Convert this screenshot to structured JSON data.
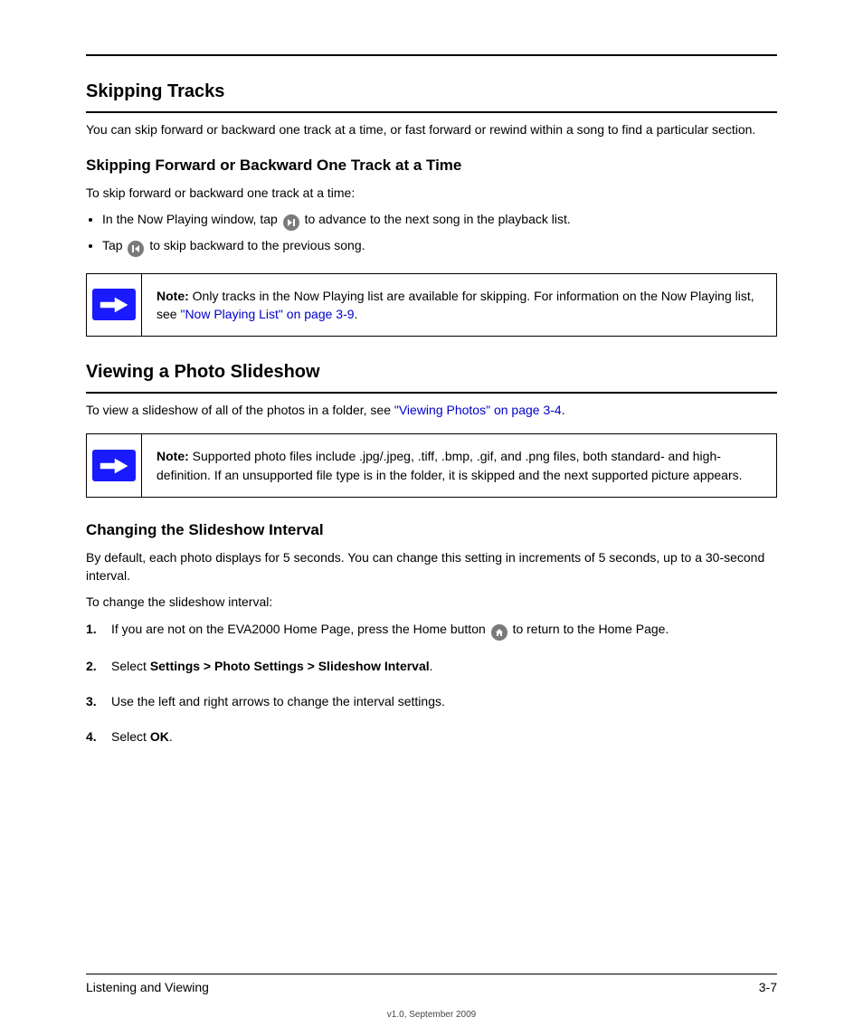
{
  "header_rule": true,
  "section1": {
    "title": "Skipping Tracks",
    "intro": "You can skip forward or backward one track at a time, or fast forward or rewind within a song to find a particular section.",
    "sub": "Skipping Forward or Backward One Track at a Time",
    "para1": "To skip forward or backward one track at a time:",
    "bullets": [
      {
        "prefix": "In the Now Playing window, tap ",
        "icon": "next",
        "suffix": " to advance to the next song in the playback list."
      },
      {
        "prefix": "Tap ",
        "icon": "prev",
        "suffix": " to skip backward to the previous song."
      }
    ],
    "note": {
      "label": "Note:",
      "text": " Only tracks in the Now Playing list are available for skipping. For information on the Now Playing list, see ",
      "link": "\"Now Playing List\" on page 3-9",
      "tail": "."
    }
  },
  "section2": {
    "title": "Viewing a Photo Slideshow",
    "intro_prefix": "To view a slideshow of all of the photos in a folder, see ",
    "intro_link": "\"Viewing Photos\" on page 3-4",
    "intro_suffix": ".",
    "note": {
      "label": "Note:",
      "text": " Supported photo files include .jpg/.jpeg, .tiff, .bmp, .gif, and .png files, both standard- and high-definition. If an unsupported file type is in the folder, it is skipped and the next supported picture appears."
    }
  },
  "section3": {
    "title": "Changing the Slideshow Interval",
    "intro": "By default, each photo displays for 5 seconds. You can change this setting in increments of 5 seconds, up to a 30-second interval.",
    "lead": "To change the slideshow interval:",
    "steps": [
      {
        "text_before": "If you are not on the EVA2000 Home Page, press the Home button ",
        "icon": "home",
        "text_after": " to return to the Home Page."
      },
      {
        "bold": "Settings > Photo Settings > Slideshow Interval",
        "prefix": "Select ",
        "suffix": "."
      },
      {
        "text": "Use the left and right arrows to change the interval settings."
      },
      {
        "bold": "OK",
        "prefix": "Select ",
        "suffix": "."
      }
    ]
  },
  "footer": {
    "left": "Listening and Viewing",
    "right": "3-7"
  },
  "version": "v1.0, September 2009"
}
